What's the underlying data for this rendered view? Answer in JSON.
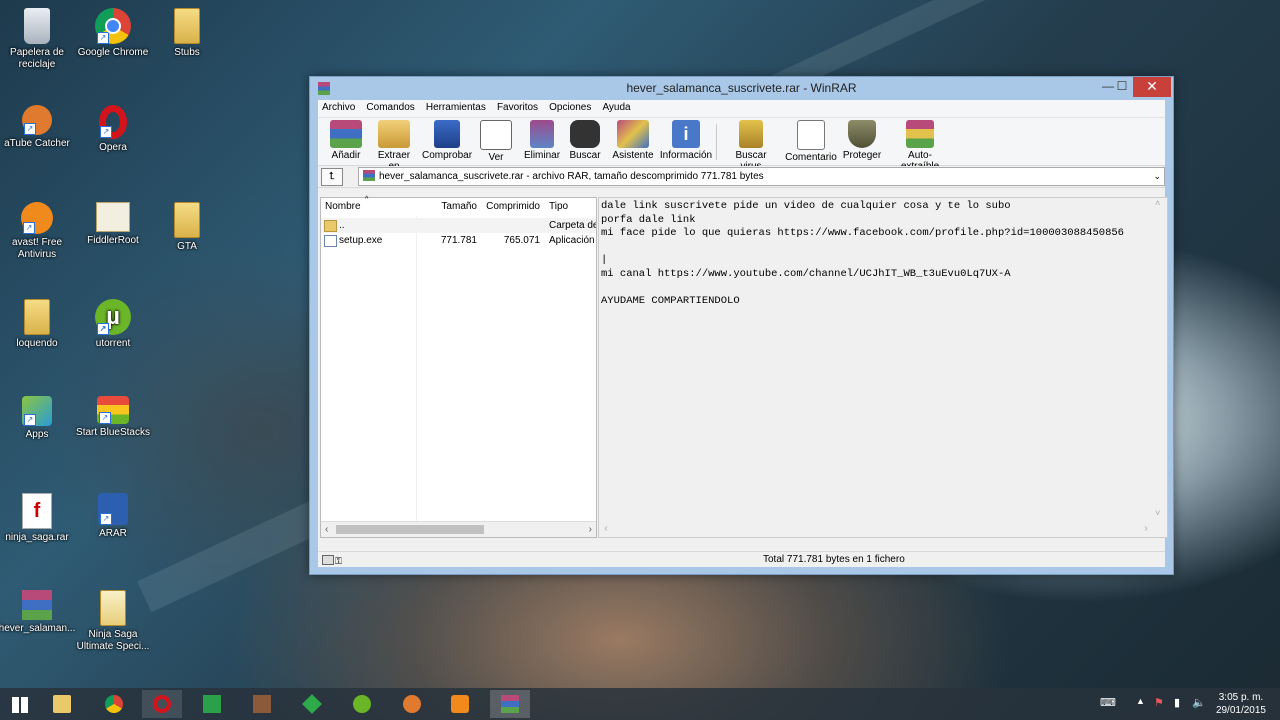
{
  "desktop": {
    "icons": [
      {
        "label": "Papelera de reciclaje",
        "icon": "recycle-bin-icon"
      },
      {
        "label": "Google Chrome",
        "icon": "chrome-icon"
      },
      {
        "label": "Stubs",
        "icon": "folder-icon"
      },
      {
        "label": "aTube Catcher",
        "icon": "atube-icon"
      },
      {
        "label": "Opera",
        "icon": "opera-icon"
      },
      {
        "label": "avast! Free Antivirus",
        "icon": "avast-icon"
      },
      {
        "label": "FiddlerRoot",
        "icon": "certificate-icon"
      },
      {
        "label": "GTA",
        "icon": "folder-icon"
      },
      {
        "label": "loquendo",
        "icon": "folder-icon"
      },
      {
        "label": "utorrent",
        "icon": "utorrent-icon"
      },
      {
        "label": "Apps",
        "icon": "bluestacks-apps-icon"
      },
      {
        "label": "Start BlueStacks",
        "icon": "bluestacks-icon"
      },
      {
        "label": "ninja_saga.rar",
        "icon": "swf-icon"
      },
      {
        "label": "ARAR",
        "icon": "arar-icon"
      },
      {
        "label": "hever_salaman...",
        "icon": "winrar-archive-icon"
      },
      {
        "label": "Ninja Saga Ultimate Speci...",
        "icon": "flash-file-icon"
      }
    ]
  },
  "window": {
    "title": "hever_salamanca_suscrivete.rar - WinRAR",
    "controls": {
      "minimize": "—",
      "maximize": "☐",
      "close": "✕"
    },
    "menu": [
      "Archivo",
      "Comandos",
      "Herramientas",
      "Favoritos",
      "Opciones",
      "Ayuda"
    ],
    "toolbar": [
      "Añadir",
      "Extraer en",
      "Comprobar",
      "Ver",
      "Eliminar",
      "Buscar",
      "Asistente",
      "Información",
      "Buscar virus",
      "Comentario",
      "Proteger",
      "Auto-extraíble"
    ],
    "address": "hever_salamanca_suscrivete.rar - archivo RAR, tamaño descomprimido 771.781 bytes",
    "columns": {
      "name": "Nombre",
      "size": "Tamaño",
      "packed": "Comprimido",
      "type": "Tipo"
    },
    "files": [
      {
        "name": "..",
        "size": "",
        "packed": "",
        "type": "Carpeta de"
      },
      {
        "name": "setup.exe",
        "size": "771.781",
        "packed": "765.071",
        "type": "Aplicación"
      }
    ],
    "comment_lines": [
      "dale link suscrivete pide un video de cualquier cosa y te lo subo",
      "porfa dale link",
      "mi face pide lo que quieras https://www.facebook.com/profile.php?id=100003088450856",
      "",
      "|",
      "mi canal https://www.youtube.com/channel/UCJhIT_WB_t3uEvu0Lq7UX-A",
      "",
      "AYUDAME COMPARTIENDOLO"
    ],
    "status": "Total 771.781 bytes en 1 fichero"
  },
  "taskbar": {
    "time": "3:05 p. m.",
    "date": "29/01/2015"
  },
  "colors": {
    "accent": "#a9c8e8",
    "close": "#c7403a",
    "taskbar": "#28323c"
  }
}
